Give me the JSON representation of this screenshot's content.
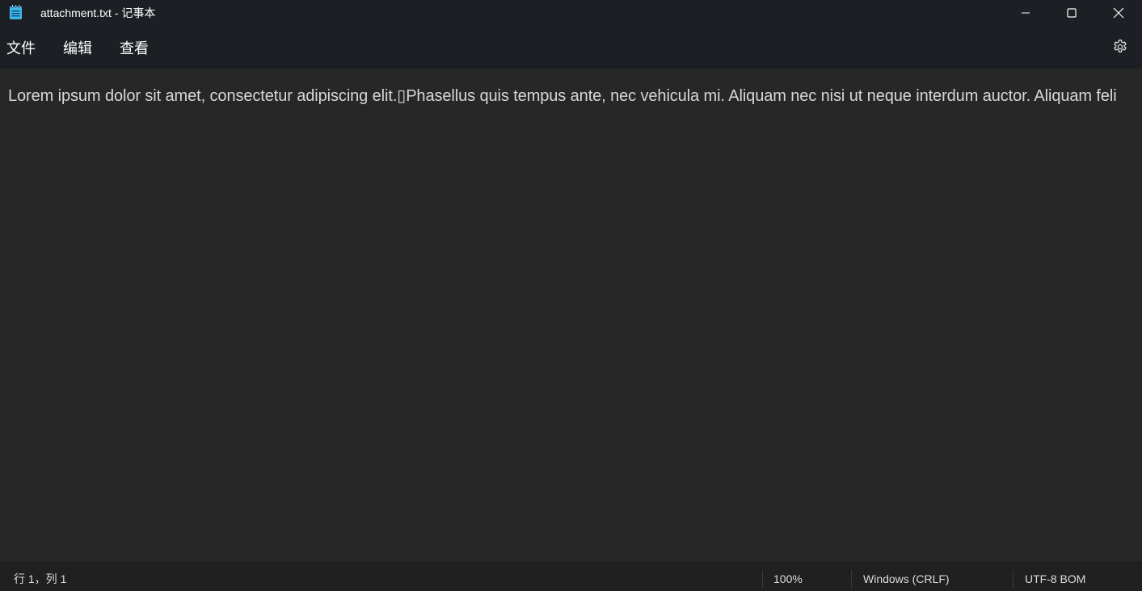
{
  "window": {
    "title": "attachment.txt - 记事本",
    "app_icon": "notepad-icon",
    "controls": {
      "minimize_icon": "minimize-icon",
      "maximize_icon": "maximize-icon",
      "close_icon": "close-icon"
    }
  },
  "menubar": {
    "items": [
      {
        "label": "文件"
      },
      {
        "label": "编辑"
      },
      {
        "label": "查看"
      }
    ],
    "settings_icon": "gear-icon"
  },
  "editor": {
    "content": "Lorem ipsum dolor sit amet, consectetur adipiscing elit.▯Phasellus quis tempus ante, nec vehicula mi. Aliquam nec nisi ut neque interdum auctor. Aliquam feli"
  },
  "statusbar": {
    "position": "行 1，列 1",
    "zoom": "100%",
    "line_ending": "Windows (CRLF)",
    "encoding": "UTF-8 BOM"
  },
  "colors": {
    "titlebar_bg": "#1c1f24",
    "editor_bg": "#272727",
    "statusbar_bg": "#202020",
    "app_icon_accent": "#3fb6e8"
  }
}
